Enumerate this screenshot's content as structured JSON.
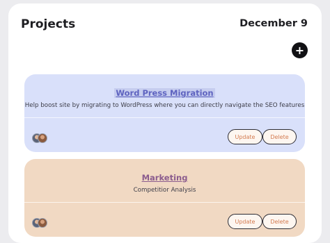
{
  "header": {
    "title": "Projects",
    "date": "December 9",
    "add_label": "+"
  },
  "projects": [
    {
      "title": "Word Press Migration",
      "description": "Help boost site by migrating to WordPress where you can directly navigate the SEO features",
      "update_label": "Update",
      "delete_label": "Delete"
    },
    {
      "title": "Marketing",
      "description": "Competitior Analysis",
      "update_label": "Update",
      "delete_label": "Delete"
    }
  ],
  "colors": {
    "card_1": "#d9e0fa",
    "card_2": "#f1d9c3",
    "button_text": "#d37a4f"
  },
  "icons": {
    "add": "plus-icon",
    "avatar": "avatar"
  }
}
